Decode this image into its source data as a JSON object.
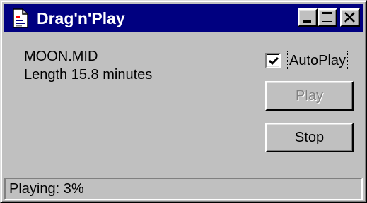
{
  "window": {
    "title": "Drag'n'Play"
  },
  "info": {
    "filename": "MOON.MID",
    "length_label": "Length",
    "length_value": "15.8",
    "length_unit": "minutes"
  },
  "controls": {
    "autoplay_label": "AutoPlay",
    "autoplay_checked": true,
    "play_label": "Play",
    "play_enabled": false,
    "stop_label": "Stop"
  },
  "status": {
    "text": "Playing: 3%",
    "progress_percent": 3
  },
  "colors": {
    "title_bar": "#000080",
    "face": "#c0c0c0",
    "disabled_text": "#808080"
  },
  "icons": {
    "app": "document-icon",
    "minimize": "minimize-icon",
    "maximize": "maximize-icon",
    "close": "close-icon",
    "check": "checkmark-icon"
  }
}
